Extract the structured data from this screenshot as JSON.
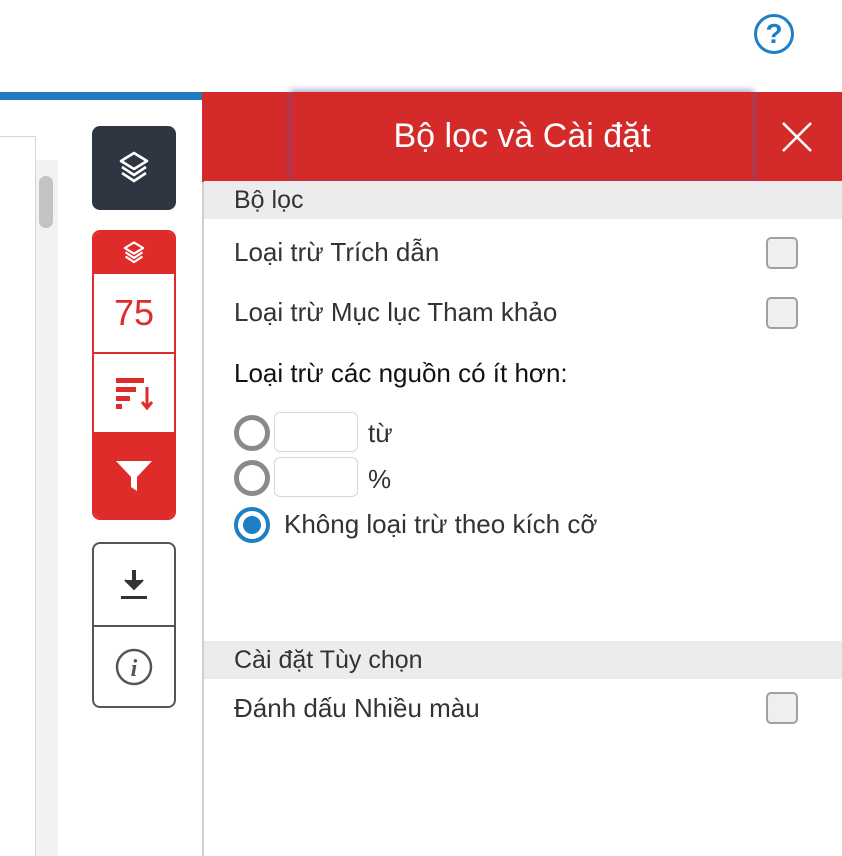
{
  "header": {
    "help_icon": "question-circle-icon",
    "help_glyph": "?"
  },
  "toolbar": {
    "layers_icon": "layers-icon",
    "match_score": "75",
    "sort_icon": "sort-icon",
    "filter_icon": "filter-icon",
    "download_icon": "download-icon",
    "info_icon": "info-icon"
  },
  "panel": {
    "title": "Bộ lọc và Cài đặt",
    "close_icon": "close-icon",
    "filters_section": "Bộ lọc",
    "exclude_quotes": "Loại trừ Trích dẫn",
    "exclude_bibliography": "Loại trừ Mục lục Tham khảo",
    "exclude_sources_label": "Loại trừ các nguồn có ít hơn:",
    "words_unit": "từ",
    "percent_unit": "%",
    "no_exclusion": "Không loại trừ theo kích cỡ",
    "words_value": "",
    "percent_value": "",
    "selected_option": "no_exclusion",
    "optional_section": "Cài đặt Tùy chọn",
    "multicolor": "Đánh dấu Nhiều màu"
  },
  "colors": {
    "accent_red": "#d42a2a",
    "accent_blue": "#1d7fc4",
    "dark_button": "#2e3642"
  }
}
